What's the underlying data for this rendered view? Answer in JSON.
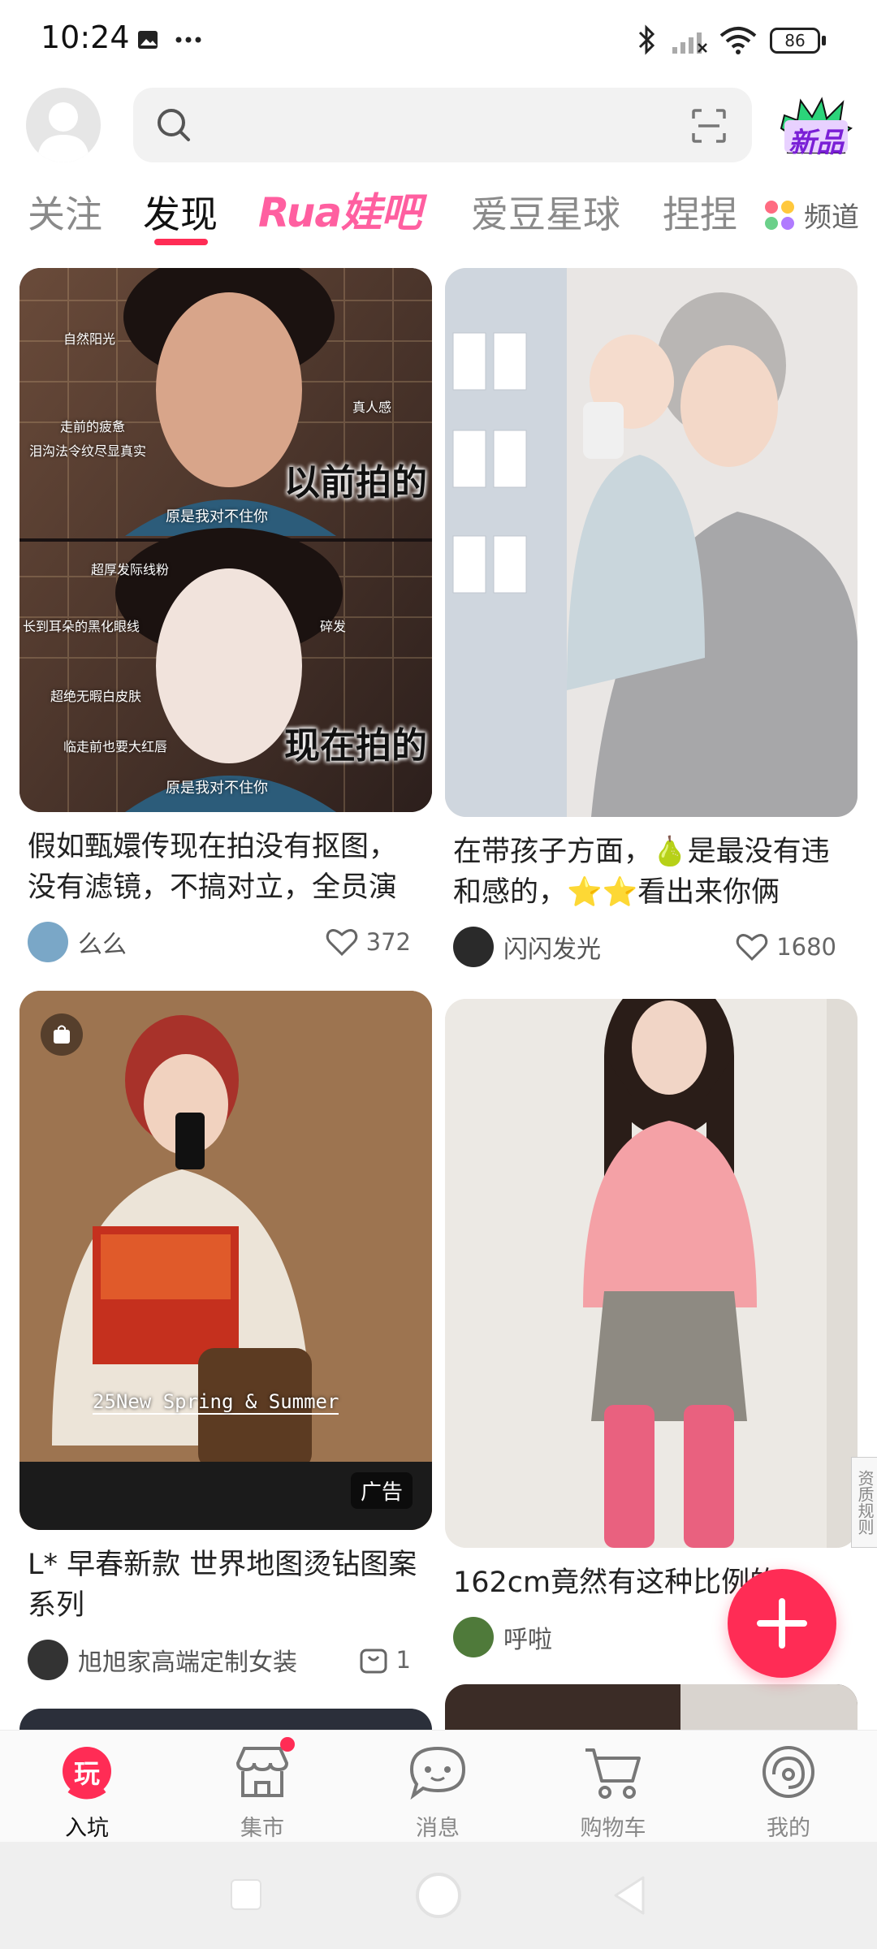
{
  "status_bar": {
    "time": "10:24",
    "battery": "86",
    "icons": [
      "gallery-icon",
      "more-dots-icon",
      "bluetooth-icon",
      "signal-icon",
      "wifi-icon",
      "battery-icon"
    ]
  },
  "header": {
    "search_placeholder": "",
    "new_badge": "新品"
  },
  "tabs": {
    "items": [
      "关注",
      "发现",
      "Rua娃吧",
      "爱豆星球",
      "捏捏"
    ],
    "active": "发现",
    "channel_label": "频道"
  },
  "feed": {
    "card1": {
      "overlay": {
        "natural_light": "自然阳光",
        "real_feel": "真人感",
        "tired": "走前的疲惫",
        "tear_line": "泪沟法令纹尽显真实",
        "subtitle_top": "原是我对不住你",
        "before": "以前拍的",
        "hairline": "超厚发际线粉",
        "eyeliner": "长到耳朵的黑化眼线",
        "bangs": "碎发",
        "skin": "超绝无暇白皮肤",
        "lipstick": "临走前也要大红唇",
        "subtitle_bottom": "原是我对不住你",
        "now": "现在拍的"
      },
      "title": "假如甄嬛传现在拍没有抠图，没有滤镜，不搞对立，全员演",
      "author": "么么",
      "likes": "372"
    },
    "card2": {
      "title": "在带孩子方面，🍐是最没有违和感的，⭐⭐看出来你俩",
      "author": "闪闪发光",
      "likes": "1680"
    },
    "card3": {
      "overlay_text": "25New Spring & Summer",
      "ad_label": "广告",
      "title": "L* 早春新款 世界地图烫钻图案系列",
      "author": "旭旭家高端定制女装",
      "count": "1"
    },
    "card4": {
      "title": "162cm竟然有这种比例的",
      "author": "呼啦"
    }
  },
  "side_tab": "资质规则",
  "bottom_nav": {
    "items": [
      {
        "label": "入坑",
        "icon": "play-icon",
        "active": true
      },
      {
        "label": "集市",
        "icon": "market-icon",
        "active": false
      },
      {
        "label": "消息",
        "icon": "message-icon",
        "active": false
      },
      {
        "label": "购物车",
        "icon": "cart-icon",
        "active": false
      },
      {
        "label": "我的",
        "icon": "profile-icon",
        "active": false
      }
    ],
    "play_glyph": "玩"
  },
  "colors": {
    "accent": "#ff2c55",
    "rua_pink": "#ff5fa0"
  }
}
